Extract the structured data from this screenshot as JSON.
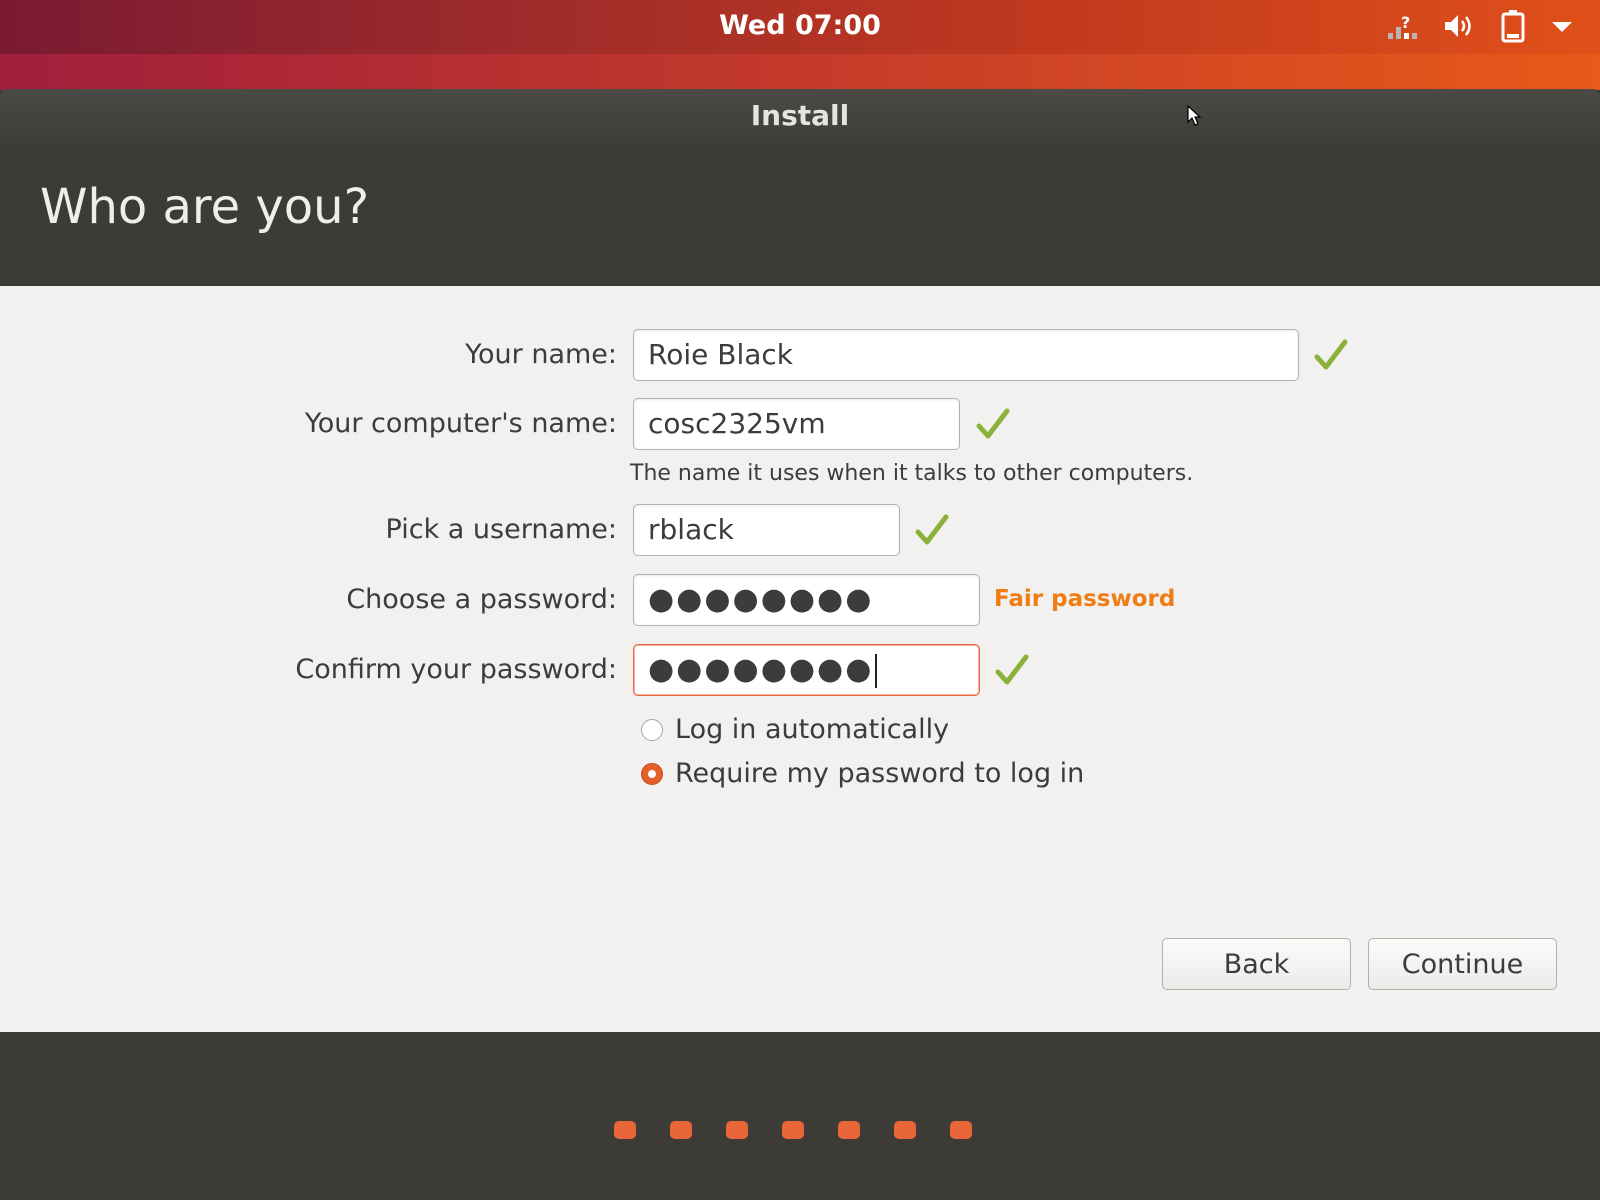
{
  "topbar": {
    "clock": "Wed 07:00",
    "icons": [
      "network-unknown-icon",
      "volume-icon",
      "battery-icon",
      "system-menu-chevron-icon"
    ]
  },
  "window": {
    "title": "Install"
  },
  "page": {
    "title": "Who are you?"
  },
  "form": {
    "name": {
      "label": "Your name:",
      "value": "Roie Black",
      "valid": true
    },
    "computer": {
      "label": "Your computer's name:",
      "value": "cosc2325vm",
      "hint": "The name it uses when it talks to other computers.",
      "valid": true
    },
    "username": {
      "label": "Pick a username:",
      "value": "rblack",
      "valid": true
    },
    "password": {
      "label": "Choose a password:",
      "masked": "●●●●●●●●",
      "strength": "Fair password"
    },
    "confirm": {
      "label": "Confirm your password:",
      "masked": "●●●●●●●●",
      "valid": true
    },
    "login_options": [
      {
        "label": "Log in automatically",
        "selected": false
      },
      {
        "label": "Require my password to log in",
        "selected": true
      }
    ]
  },
  "buttons": {
    "back": "Back",
    "continue": "Continue"
  },
  "progress": {
    "steps_total": 7
  },
  "colors": {
    "accent": "#e9663b",
    "check": "#8ab23a",
    "strength_fair": "#f07c14"
  }
}
